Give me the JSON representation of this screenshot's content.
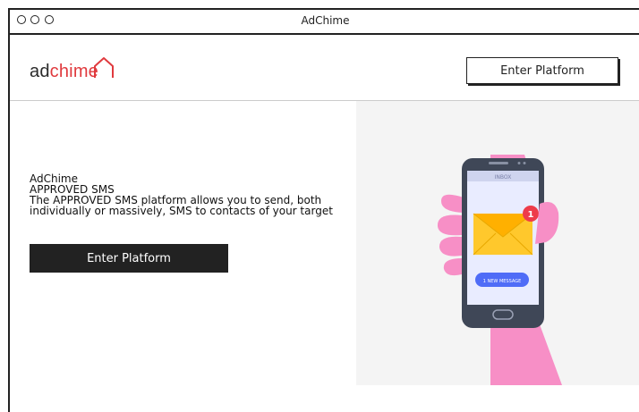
{
  "window": {
    "title": "AdChime"
  },
  "logo": {
    "part1": "ad",
    "part2": "chime"
  },
  "header": {
    "enter_label": "Enter Platform"
  },
  "hero": {
    "line1": "AdChime",
    "line2": "APPROVED SMS",
    "line3": "The APPROVED SMS platform allows you to send, both",
    "line4": "individually or massively, SMS to contacts of your target",
    "enter_label": "Enter Platform"
  },
  "illustration": {
    "inbox_label": "INBOX",
    "badge_count": "1",
    "message_pill": "1 NEW MESSAGE"
  },
  "colors": {
    "brand_red": "#e03a3e",
    "dark_button": "#222222",
    "hand_pink": "#f78fc6",
    "envelope_yellow": "#ffc82c",
    "pill_blue": "#4f6cf7"
  }
}
